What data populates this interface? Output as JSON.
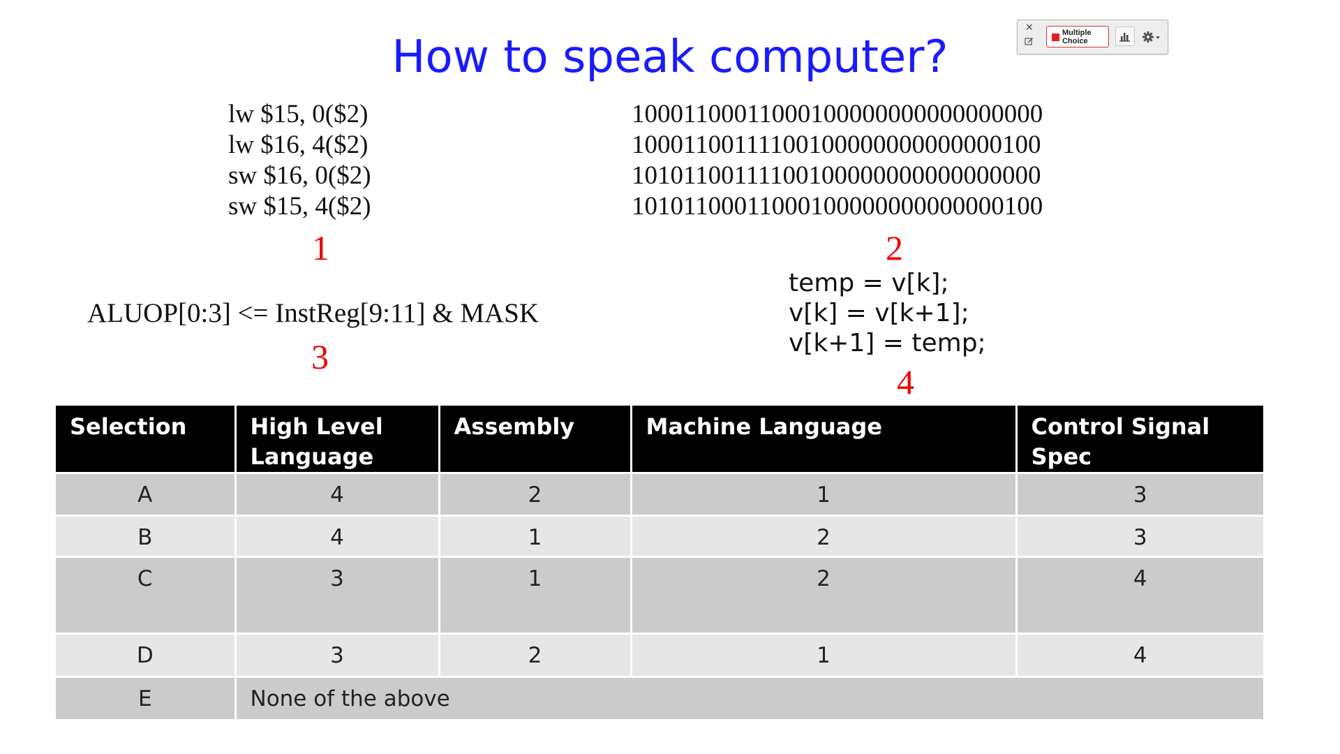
{
  "slide": {
    "title": "How to speak computer?",
    "assembly_lines": [
      "lw $15, 0($2)",
      "lw $16, 4($2)",
      "sw $16, 0($2)",
      "sw $15, 4($2)"
    ],
    "machine_lines": [
      "10001100011000100000000000000000",
      "10001100111100100000000000000100",
      "10101100111100100000000000000000",
      "10101100011000100000000000000100"
    ],
    "control_signal_line": "ALUOP[0:3] <= InstReg[9:11] & MASK",
    "high_level_lines": [
      "temp = v[k];",
      "v[k] = v[k+1];",
      "v[k+1] = temp;"
    ],
    "labels": {
      "one": "1",
      "two": "2",
      "three": "3",
      "four": "4"
    },
    "text_color": "#111111",
    "title_color": "#1a1aff",
    "label_color": "#ee0000"
  },
  "toolbar": {
    "close_icon": "×",
    "mode_label_line1": "Multiple",
    "mode_label_line2": "Choice",
    "mode_color": "#e02020",
    "icons": [
      "close-icon",
      "edit-icon",
      "bar-chart-icon",
      "gear-icon",
      "chevron-down-icon"
    ]
  },
  "table": {
    "headers": [
      [
        "Selection",
        ""
      ],
      [
        "High Level",
        "Language"
      ],
      [
        "Assembly",
        ""
      ],
      [
        "Machine Language",
        ""
      ],
      [
        "Control Signal",
        "Spec"
      ]
    ],
    "rows": [
      {
        "selection": "A",
        "high_level": "4",
        "assembly": "2",
        "machine": "1",
        "control": "3"
      },
      {
        "selection": "B",
        "high_level": "4",
        "assembly": "1",
        "machine": "2",
        "control": "3"
      },
      {
        "selection": "C",
        "high_level": "3",
        "assembly": "1",
        "machine": "2",
        "control": "4"
      },
      {
        "selection": "D",
        "high_level": "3",
        "assembly": "2",
        "machine": "1",
        "control": "4"
      },
      {
        "selection": "E",
        "merged_text": "None of the above"
      }
    ],
    "header_bg": "#000000",
    "row_dark_bg": "#cbcbcb",
    "row_light_bg": "#e6e6e6"
  }
}
